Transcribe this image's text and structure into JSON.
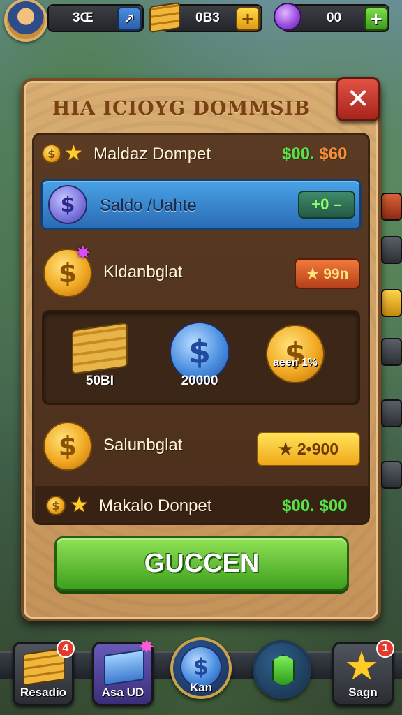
{
  "topbar": {
    "resource1_value": "3Œ",
    "resource2_value": "0B3",
    "resource3_value": "00",
    "add_symbol": "+"
  },
  "panel": {
    "title": "HIA ICIOYG DOMMSIB",
    "close_symbol": "✕"
  },
  "rows": {
    "row1_label": "Maldaz Dompet",
    "row1_value": "$00.",
    "row1_value2": "$60",
    "saldo_label": "Saldo /Uahte",
    "saldo_pill": "+0 –",
    "row3_label": "Kldanbglat",
    "row3_pill": "★ 99n",
    "row4_label": "Salunbglat",
    "row4_pill": "★ 2•900",
    "row5_label": "Makalo Donpet",
    "row5_value": "$00. $00"
  },
  "tray": {
    "item1": "50BI",
    "item2": "20000",
    "item3": "aeen 1%"
  },
  "cta_label": "GUCCEN",
  "nav": {
    "item1": "Resadio",
    "item1_badge": "4",
    "item2": "Asa UD",
    "item3": "Kan",
    "item5": "Sagn",
    "item5_badge": "1"
  },
  "colors": {
    "panel": "#c4935a",
    "cta": "#3fa01e",
    "close": "#c5352a",
    "accent_green": "#5fe04a"
  }
}
